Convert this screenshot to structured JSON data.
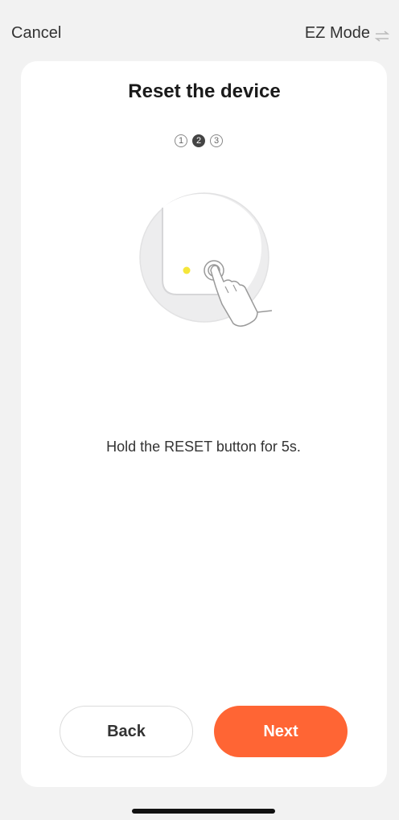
{
  "topbar": {
    "cancel_label": "Cancel",
    "mode_label": "EZ Mode",
    "mode_icon": "swap-arrows-icon"
  },
  "card": {
    "title": "Reset the device",
    "steps": [
      "1",
      "2",
      "3"
    ],
    "active_step": 2,
    "illustration": "reset-button-press-illustration",
    "instruction": "Hold the RESET button for 5s."
  },
  "buttons": {
    "back_label": "Back",
    "next_label": "Next"
  },
  "colors": {
    "accent": "#ff6534",
    "background": "#f2f2f2",
    "card": "#ffffff",
    "indicator_light": "#f5e63a"
  }
}
